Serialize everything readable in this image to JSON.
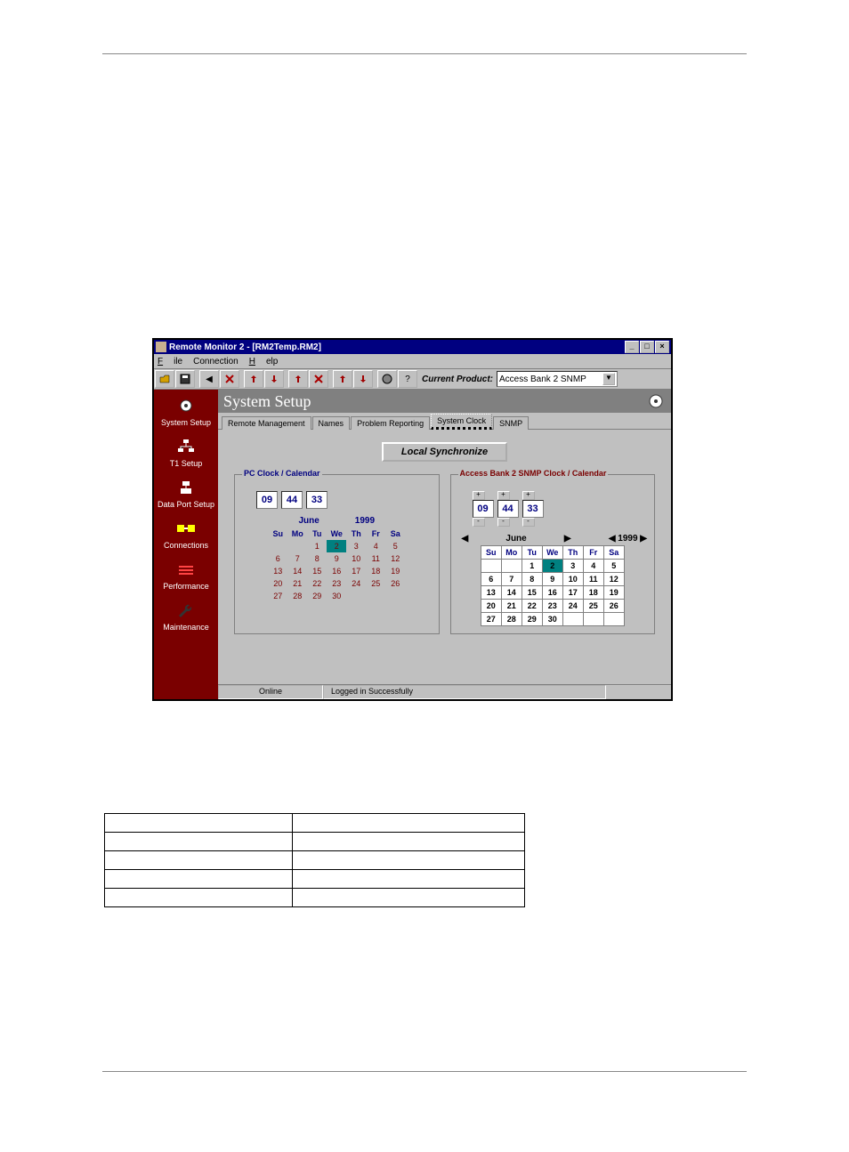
{
  "window": {
    "title": "Remote Monitor 2 - [RM2Temp.RM2]",
    "menus": {
      "file": "File",
      "conn": "Connection",
      "help": "Help"
    },
    "current_product_label": "Current Product:",
    "current_product": "Access Bank 2 SNMP"
  },
  "sidebar": {
    "items": [
      {
        "label": "System Setup"
      },
      {
        "label": "T1 Setup"
      },
      {
        "label": "Data Port Setup"
      },
      {
        "label": "Connections"
      },
      {
        "label": "Performance"
      },
      {
        "label": "Maintenance"
      }
    ]
  },
  "main": {
    "title": "System Setup",
    "tabs": {
      "remote": "Remote Management",
      "names": "Names",
      "problem": "Problem Reporting",
      "clock": "System Clock",
      "snmp": "SNMP"
    },
    "sync_btn": "Local Synchronize",
    "pc_legend": "PC Clock / Calendar",
    "ab_legend": "Access Bank 2 SNMP Clock / Calendar",
    "time": {
      "h": "09",
      "m": "44",
      "s": "33"
    },
    "month": "June",
    "year": "1999",
    "year_nav": "◀ 1999 ▶",
    "dow": [
      "Su",
      "Mo",
      "Tu",
      "We",
      "Th",
      "Fr",
      "Sa"
    ],
    "pc_cal": [
      [
        "",
        "",
        "1",
        "2",
        "3",
        "4",
        "5"
      ],
      [
        "6",
        "7",
        "8",
        "9",
        "10",
        "11",
        "12"
      ],
      [
        "13",
        "14",
        "15",
        "16",
        "17",
        "18",
        "19"
      ],
      [
        "20",
        "21",
        "22",
        "23",
        "24",
        "25",
        "26"
      ],
      [
        "27",
        "28",
        "29",
        "30",
        "",
        "",
        ""
      ]
    ],
    "ab_cal": [
      [
        "",
        "",
        "1",
        "2",
        "3",
        "4",
        "5"
      ],
      [
        "6",
        "7",
        "8",
        "9",
        "10",
        "11",
        "12"
      ],
      [
        "13",
        "14",
        "15",
        "16",
        "17",
        "18",
        "19"
      ],
      [
        "20",
        "21",
        "22",
        "23",
        "24",
        "25",
        "26"
      ],
      [
        "27",
        "28",
        "29",
        "30",
        "",
        "",
        ""
      ]
    ]
  },
  "status": {
    "a": "Online",
    "b": "Logged in Successfully"
  }
}
